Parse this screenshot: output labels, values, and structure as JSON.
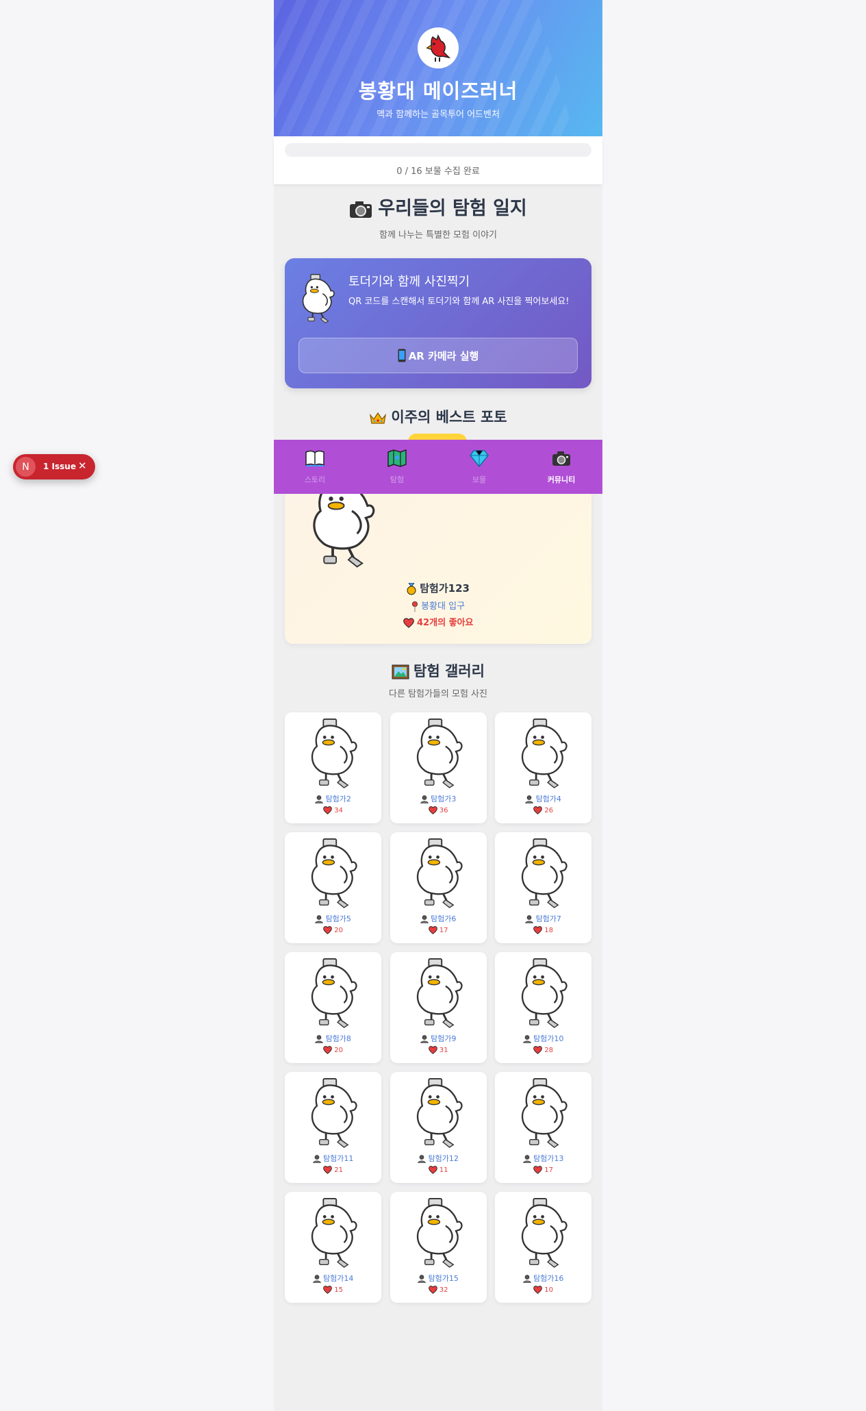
{
  "header": {
    "title": "봉황대 메이즈러너",
    "subtitle": "맥과 함께하는 골목투어 어드벤처",
    "logo_icon": "cardinal-bird-icon"
  },
  "progress": {
    "text": "0 / 16 보물 수집 완료",
    "fraction": 0
  },
  "journal": {
    "title": "우리들의 탐험 일지",
    "subtitle": "함께 나누는 특별한 모험 이야기",
    "icon": "camera-icon"
  },
  "ar_card": {
    "title": "토더기와 함께 사진찍기",
    "description": "QR 코드를 스캔해서 토더기와 함께 AR 사진을 찍어보세요!",
    "button_label": "AR 카메라 실행",
    "button_icon": "phone-icon"
  },
  "best_photo": {
    "title": "이주의 베스트 포토",
    "title_icon": "crown-icon",
    "user": "탐험가123",
    "location": "봉황대 입구",
    "likes": "42개의 좋아요"
  },
  "nav": {
    "items": [
      {
        "label": "스토리",
        "icon": "book-icon"
      },
      {
        "label": "탐험",
        "icon": "map-icon"
      },
      {
        "label": "보물",
        "icon": "gem-icon"
      },
      {
        "label": "커뮤니티",
        "icon": "camera-icon"
      }
    ],
    "active_index": 3,
    "background": "#b04fd6"
  },
  "gallery": {
    "title": "탐험 갤러리",
    "subtitle": "다른 탐험가들의 모험 사진",
    "icon": "framed-picture-icon",
    "photos": [
      {
        "user": "탐험가2",
        "likes": "34"
      },
      {
        "user": "탐험가3",
        "likes": "36"
      },
      {
        "user": "탐험가4",
        "likes": "26"
      },
      {
        "user": "탐험가5",
        "likes": "20"
      },
      {
        "user": "탐험가6",
        "likes": "17"
      },
      {
        "user": "탐험가7",
        "likes": "18"
      },
      {
        "user": "탐험가8",
        "likes": "20"
      },
      {
        "user": "탐험가9",
        "likes": "31"
      },
      {
        "user": "탐험가10",
        "likes": "28"
      },
      {
        "user": "탐험가11",
        "likes": "21"
      },
      {
        "user": "탐험가12",
        "likes": "11"
      },
      {
        "user": "탐험가13",
        "likes": "17"
      },
      {
        "user": "탐험가14",
        "likes": "15"
      },
      {
        "user": "탐험가15",
        "likes": "32"
      },
      {
        "user": "탐험가16",
        "likes": "10"
      }
    ]
  },
  "dev_overlay": {
    "badge_letter": "N",
    "text": "1 Issue",
    "close_icon": "close-icon"
  },
  "colors": {
    "accent": "#667eea",
    "heart": "#e53e3e",
    "link": "#4a7bd8"
  }
}
